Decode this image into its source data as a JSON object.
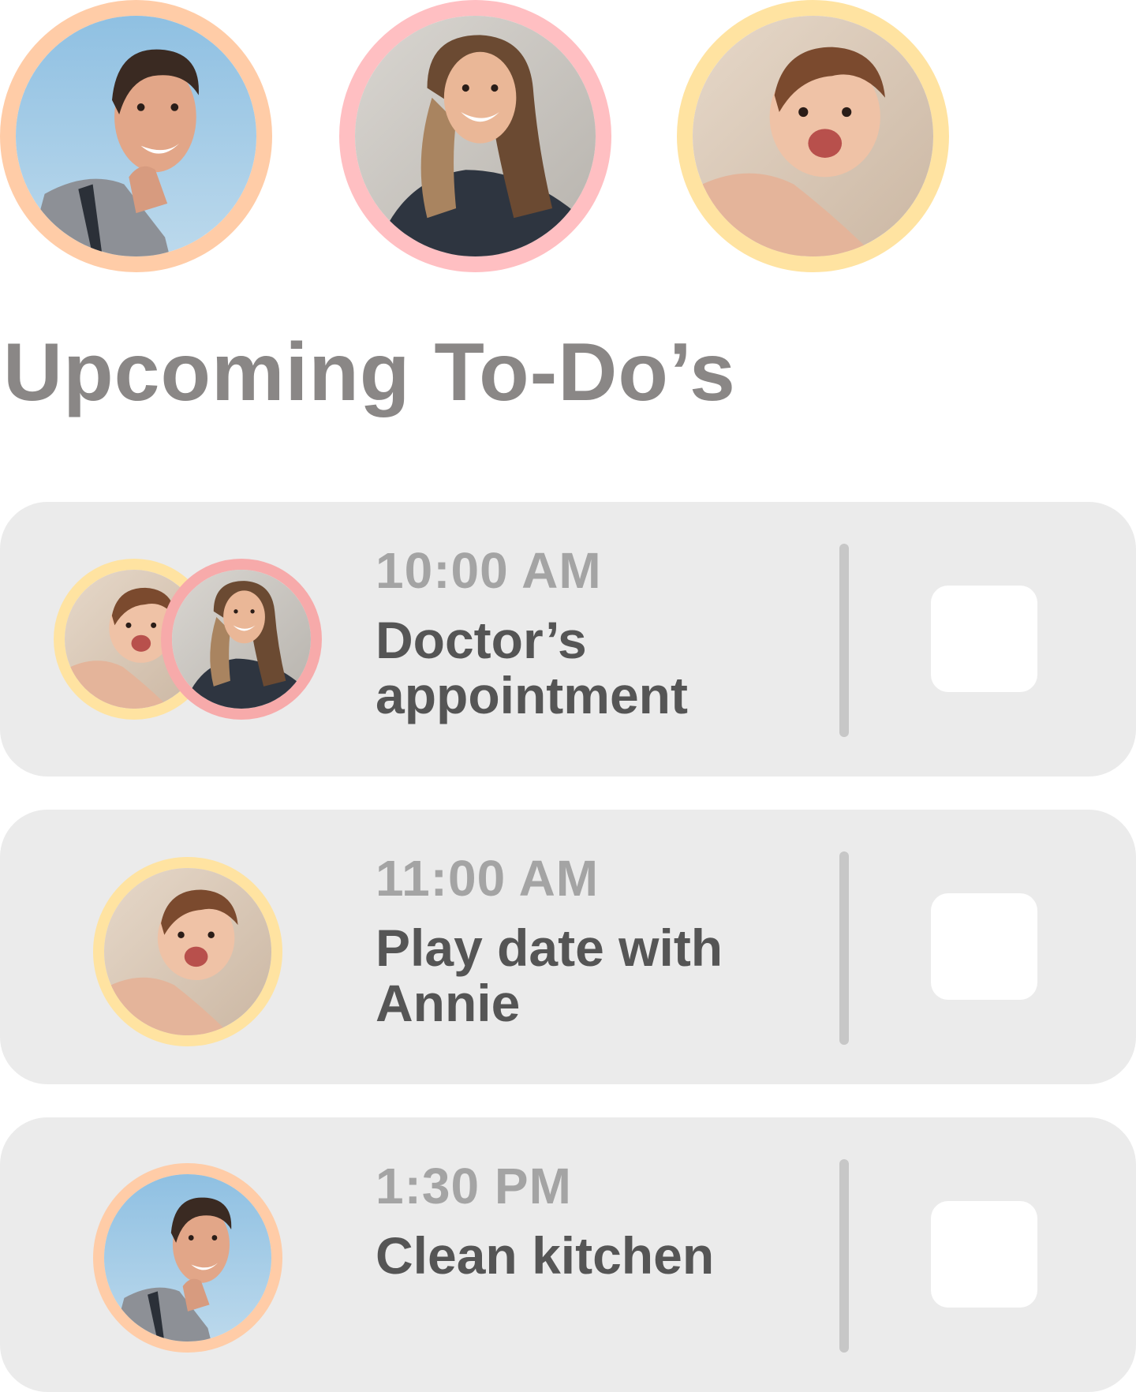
{
  "family": {
    "members": [
      {
        "ring_color": "#ffcca7",
        "icon": "man-avatar-photo"
      },
      {
        "ring_color": "#ffbfc2",
        "icon": "woman-avatar-photo"
      },
      {
        "ring_color": "#ffe3a1",
        "icon": "baby-avatar-photo"
      }
    ]
  },
  "page_title": "Upcoming To-Do’s",
  "todos": [
    {
      "time": "10:00 AM",
      "title": "Doctor’s appointment",
      "checked": false,
      "assignees": [
        "baby",
        "woman"
      ]
    },
    {
      "time": "11:00 AM",
      "title": "Play date with Annie",
      "checked": false,
      "assignees": [
        "baby"
      ]
    },
    {
      "time": "1:30 PM",
      "title": "Clean kitchen",
      "checked": false,
      "assignees": [
        "man"
      ]
    }
  ],
  "colors": {
    "man_ring": "#ffcca7",
    "woman_ring": "#ffbfc2",
    "woman_ring_small": "#f7aaaa",
    "baby_ring": "#ffe3a1",
    "card_bg": "#ebebeb",
    "title_gray": "#8a8786",
    "time_gray": "#a4a4a4",
    "task_gray": "#555555"
  }
}
